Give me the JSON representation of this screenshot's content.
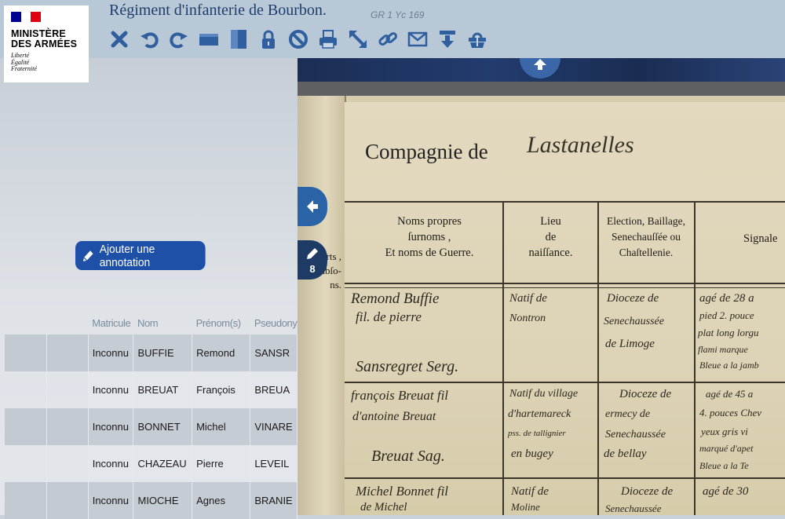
{
  "header": {
    "logo": {
      "title_line1": "MINISTÈRE",
      "title_line2": "DES ARMÉES",
      "motto_line1": "Liberté",
      "motto_line2": "Égalité",
      "motto_line3": "Fraternité"
    },
    "title": "Régiment d'infanterie de Bourbon.",
    "cote": "GR 1 Yc 169",
    "toolbar": [
      {
        "icon": "close-icon"
      },
      {
        "icon": "rotate-left-icon"
      },
      {
        "icon": "rotate-right-icon"
      },
      {
        "icon": "fit-width-icon"
      },
      {
        "icon": "fit-height-icon"
      },
      {
        "icon": "lock-icon"
      },
      {
        "icon": "forbidden-icon"
      },
      {
        "icon": "print-icon"
      },
      {
        "icon": "fullscreen-icon"
      },
      {
        "icon": "link-icon"
      },
      {
        "icon": "email-icon"
      },
      {
        "icon": "download-icon"
      },
      {
        "icon": "basket-icon"
      }
    ]
  },
  "annotation_button": {
    "label": "Ajouter une annotation"
  },
  "table": {
    "columns": [
      "",
      "",
      "Matricule",
      "Nom",
      "Prénom(s)",
      "Pseudony"
    ],
    "rows": [
      {
        "matricule": "Inconnu",
        "nom": "BUFFIE",
        "prenom": "Remond",
        "pseudonyme": "SANSR"
      },
      {
        "matricule": "Inconnu",
        "nom": "BREUAT",
        "prenom": "François",
        "pseudonyme": "BREUA"
      },
      {
        "matricule": "Inconnu",
        "nom": "BONNET",
        "prenom": "Michel",
        "pseudonyme": "VINARE"
      },
      {
        "matricule": "Inconnu",
        "nom": "CHAZEAU",
        "prenom": "Pierre",
        "pseudonyme": "LEVEIL"
      },
      {
        "matricule": "Inconnu",
        "nom": "MIOCHE",
        "prenom": "Agnes",
        "pseudonyme": "BRANIE"
      }
    ]
  },
  "viewer": {
    "annotation_count": "8",
    "document": {
      "company_title": "Compagnie de",
      "company_name": "Lastanelles",
      "left_margin_lines": [
        "orts ,",
        "gez abſo-",
        "ns."
      ],
      "headers": {
        "noms": [
          "Noms propres",
          "ſurnoms ,",
          "Et noms de Guerre."
        ],
        "lieu": [
          "Lieu",
          "de",
          "naiſſance."
        ],
        "election": [
          "Election, Baillage,",
          "Senechauſſée ou",
          "Chaſtellenie."
        ],
        "signalement": [
          "Signale"
        ]
      },
      "entries": [
        {
          "noms": [
            "Remond Buffie",
            "fil. de pierre",
            "Sansregret Serg."
          ],
          "lieu": [
            "Natif de",
            "Nontron"
          ],
          "election": [
            "Dioceze de",
            "Senechaussée",
            "de Limoge"
          ],
          "signalement": [
            "agé de 28 a",
            "pied 2. pouce",
            "plat long lorgu",
            "flami marque",
            "Bleue a la jamb"
          ]
        },
        {
          "noms": [
            "françois Breuat fil",
            "d'antoine Breuat",
            "Breuat Sag."
          ],
          "lieu": [
            "Natif du village",
            "d'hartemareck",
            "pss. de tallignier",
            "en bugey"
          ],
          "election": [
            "Dioceze de",
            "ermecy de",
            "Senechaussée",
            "de bellay"
          ],
          "signalement": [
            "agé de 45 a",
            "4. pouces Chev",
            "yeux gris vi",
            "marqué d'apet",
            "Bleue a la Te"
          ]
        },
        {
          "noms": [
            "Michel Bonnet fil",
            "de Michel"
          ],
          "lieu": [
            "Natif de",
            "Moline"
          ],
          "election": [
            "Dioceze de",
            "Senechaussée"
          ],
          "signalement": [
            "agé de 30"
          ]
        }
      ]
    }
  }
}
